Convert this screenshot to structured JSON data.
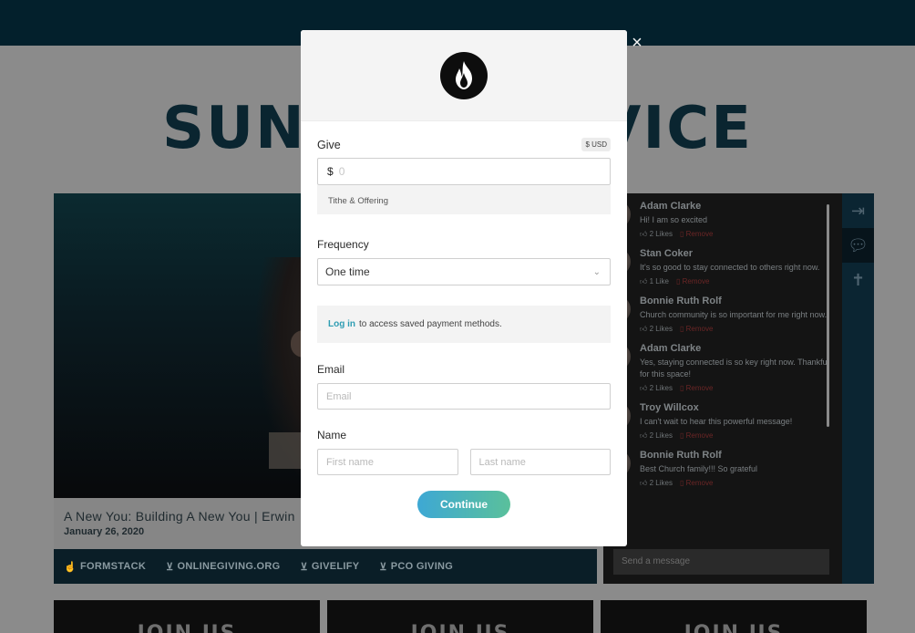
{
  "page": {
    "hero_title": "SUNDAY SERVICE",
    "video": {
      "title": "A New You: Building A New You | Erwin",
      "date": "January 26, 2020"
    },
    "give_links": [
      {
        "label": "FORMSTACK",
        "icon": "hand-icon"
      },
      {
        "label": "ONLINEGIVING.ORG",
        "icon": "give-hand-icon"
      },
      {
        "label": "GIVELIFY",
        "icon": "give-hand-icon"
      },
      {
        "label": "PCO GIVING",
        "icon": "give-hand-icon"
      }
    ],
    "thumbnails": [
      "JOIN US",
      "JOIN US",
      "JOIN US"
    ]
  },
  "chat": {
    "messages": [
      {
        "name": "Adam Clarke",
        "text": "Hi! I am so excited",
        "likes": "2 Likes",
        "remove": "Remove"
      },
      {
        "name": "Stan Coker",
        "text": "It's so good to stay connected to others right now.",
        "likes": "1 Like",
        "remove": "Remove"
      },
      {
        "name": "Bonnie Ruth Rolf",
        "text": "Church community is so important for me right now.",
        "likes": "2 Likes",
        "remove": "Remove"
      },
      {
        "name": "Adam Clarke",
        "text": "Yes, staying connected is so key right now. Thankful for this space!",
        "likes": "2 Likes",
        "remove": "Remove"
      },
      {
        "name": "Troy Willcox",
        "text": "I can't wait to hear this powerful message!",
        "likes": "2 Likes",
        "remove": "Remove"
      },
      {
        "name": "Bonnie Ruth Rolf",
        "text": "Best Church family!!! So grateful",
        "likes": "2 Likes",
        "remove": "Remove"
      }
    ],
    "input_placeholder": "Send a message"
  },
  "modal": {
    "close": "×",
    "give_label": "Give",
    "currency": "$ USD",
    "amount_symbol": "$",
    "amount_value": "0",
    "fund": "Tithe & Offering",
    "frequency_label": "Frequency",
    "frequency_value": "One time",
    "login_link": "Log in",
    "login_text": "to access saved payment methods.",
    "email_label": "Email",
    "email_placeholder": "Email",
    "name_label": "Name",
    "first_name_placeholder": "First name",
    "last_name_placeholder": "Last name",
    "continue_label": "Continue"
  },
  "colors": {
    "topbar": "#03202c",
    "accent_blue": "#3ea8d4",
    "accent_green": "#5ac09b",
    "link": "#2f9db3"
  }
}
